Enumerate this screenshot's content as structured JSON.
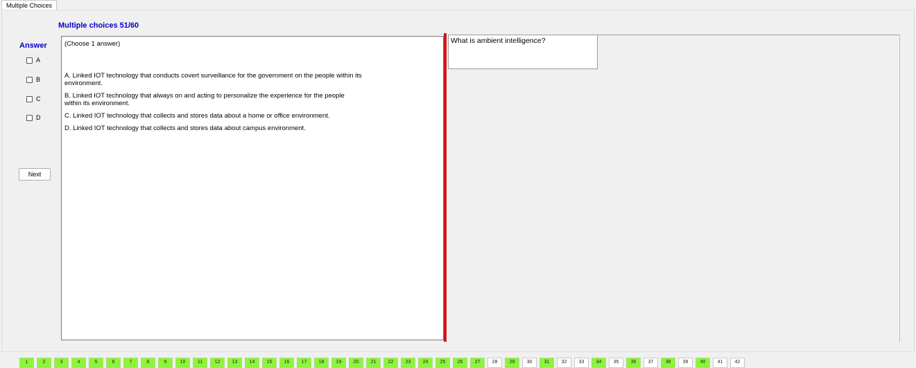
{
  "tab_label": "Multiple Choices",
  "header": {
    "title": "Multiple choices 51/60"
  },
  "answer": {
    "label": "Answer",
    "options": [
      "A",
      "B",
      "C",
      "D"
    ],
    "next_label": "Next"
  },
  "content": {
    "instruction": "(Choose 1 answer)",
    "choices": [
      "A.  Linked IOT technology that conducts covert surveillance for the government on the people within its environment.",
      "B.  Linked IOT technology that always on and acting to personalize the experience for the people within its environment.",
      "C.  Linked IOT technology that collects and stores data about a home or office environment.",
      "D.  Linked IOT technology that collects and stores data about campus environment."
    ]
  },
  "question": "What is ambient intelligence?",
  "colors": {
    "done": "#8cf53a",
    "divider": "#d4141a",
    "title": "#0000cc"
  },
  "nav": [
    {
      "label": "1",
      "done": true
    },
    {
      "label": "2",
      "done": true
    },
    {
      "label": "3",
      "done": true
    },
    {
      "label": "4",
      "done": true
    },
    {
      "label": "5",
      "done": true
    },
    {
      "label": "6",
      "done": true
    },
    {
      "label": "7",
      "done": true
    },
    {
      "label": "8",
      "done": true
    },
    {
      "label": "9",
      "done": true
    },
    {
      "label": "10",
      "done": true
    },
    {
      "label": "11",
      "done": true
    },
    {
      "label": "12",
      "done": true
    },
    {
      "label": "13",
      "done": true
    },
    {
      "label": "14",
      "done": true
    },
    {
      "label": "15",
      "done": true
    },
    {
      "label": "16",
      "done": true
    },
    {
      "label": "17",
      "done": true
    },
    {
      "label": "18",
      "done": true
    },
    {
      "label": "19",
      "done": true
    },
    {
      "label": "20",
      "done": true
    },
    {
      "label": "21",
      "done": true
    },
    {
      "label": "22",
      "done": true
    },
    {
      "label": "23",
      "done": true
    },
    {
      "label": "24",
      "done": true
    },
    {
      "label": "25",
      "done": true
    },
    {
      "label": "26",
      "done": true
    },
    {
      "label": "27",
      "done": true
    },
    {
      "label": "28",
      "done": false
    },
    {
      "label": "29",
      "done": true
    },
    {
      "label": "30",
      "done": false
    },
    {
      "label": "31",
      "done": true
    },
    {
      "label": "32",
      "done": false
    },
    {
      "label": "33",
      "done": false
    },
    {
      "label": "34",
      "done": true
    },
    {
      "label": "35",
      "done": false
    },
    {
      "label": "36",
      "done": true
    },
    {
      "label": "37",
      "done": false
    },
    {
      "label": "38",
      "done": true
    },
    {
      "label": "39",
      "done": false
    },
    {
      "label": "40",
      "done": true
    },
    {
      "label": "41",
      "done": false
    },
    {
      "label": "42",
      "done": false
    }
  ]
}
